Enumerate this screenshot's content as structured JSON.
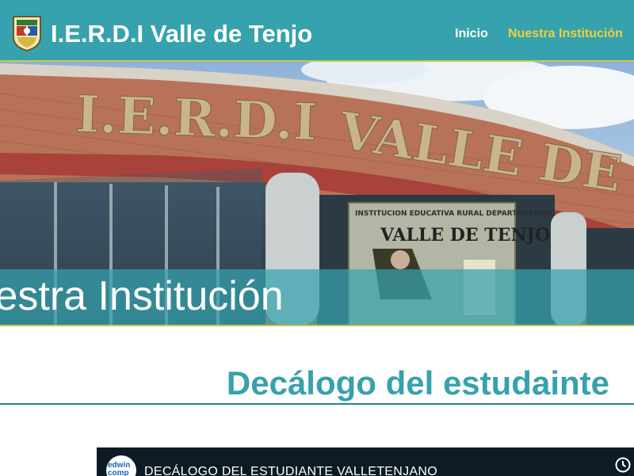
{
  "header": {
    "site_title": "I.E.R.D.I Valle de Tenjo",
    "nav": [
      {
        "label": "Inicio"
      },
      {
        "label": "Nuestra Institución"
      }
    ],
    "colors": {
      "bar": "#36a2ae",
      "active_link": "#f1cf3c"
    }
  },
  "hero": {
    "title": "Nuestra Institución",
    "sign_text": "I.E.R.D.I VALLE DE TENJO",
    "plaque_top": "INSTITUCION EDUCATIVA RURAL DEPARTAMENTAL",
    "plaque_main": "VALLE DE TENJO"
  },
  "section": {
    "title": "Decálogo del estudainte"
  },
  "video": {
    "title": "DECÁLOGO DEL ESTUDIANTE VALLETENJANO",
    "channel": "edwin comp"
  }
}
